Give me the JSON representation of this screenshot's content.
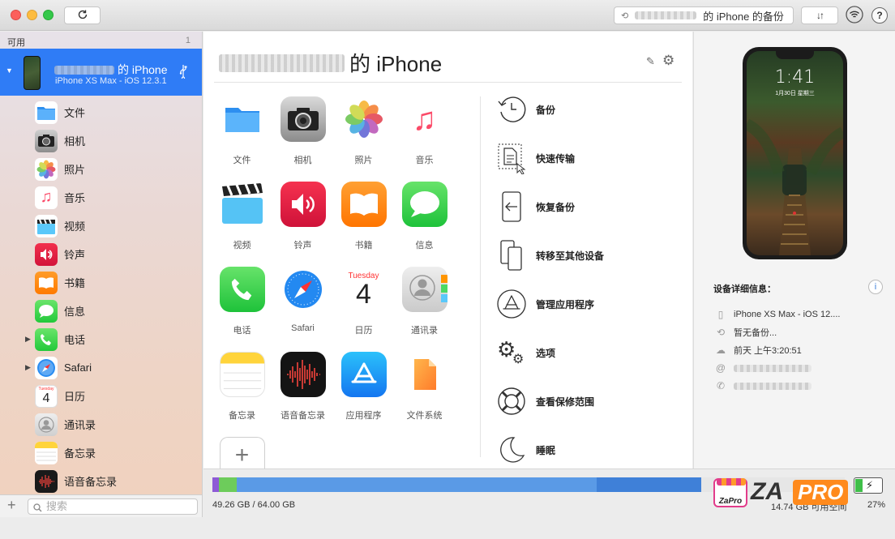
{
  "titlebar": {
    "refresh_icon": "refresh-icon",
    "backup_button_label": "的 iPhone 的备份",
    "transfer_icon": "transfer-arrows-icon",
    "wifi_icon": "wifi-icon",
    "help_label": "?"
  },
  "sidebar": {
    "section_label": "可用",
    "section_count": "1",
    "device": {
      "name": "的 iPhone",
      "subtitle": "iPhone XS Max - iOS 12.3.1",
      "usb_icon": "usb-icon"
    },
    "items": [
      {
        "label": "文件",
        "icon": "files-icon"
      },
      {
        "label": "相机",
        "icon": "camera-icon"
      },
      {
        "label": "照片",
        "icon": "photos-icon"
      },
      {
        "label": "音乐",
        "icon": "music-icon"
      },
      {
        "label": "视频",
        "icon": "video-icon"
      },
      {
        "label": "铃声",
        "icon": "ringtone-icon"
      },
      {
        "label": "书籍",
        "icon": "books-icon"
      },
      {
        "label": "信息",
        "icon": "messages-icon"
      },
      {
        "label": "电话",
        "icon": "phone-icon"
      },
      {
        "label": "Safari",
        "icon": "safari-icon"
      },
      {
        "label": "日历",
        "icon": "calendar-icon",
        "day": "4",
        "weekday": "Tuesday"
      },
      {
        "label": "通讯录",
        "icon": "contacts-icon"
      },
      {
        "label": "备忘录",
        "icon": "notes-icon"
      },
      {
        "label": "语音备忘录",
        "icon": "voice-memos-icon"
      }
    ],
    "add_label": "+",
    "search_placeholder": "搜索"
  },
  "main": {
    "title": "的 iPhone",
    "apps": [
      {
        "label": "文件"
      },
      {
        "label": "相机"
      },
      {
        "label": "照片"
      },
      {
        "label": "音乐"
      },
      {
        "label": "视频"
      },
      {
        "label": "铃声"
      },
      {
        "label": "书籍"
      },
      {
        "label": "信息"
      },
      {
        "label": "电话"
      },
      {
        "label": "Safari"
      },
      {
        "label": "日历"
      },
      {
        "label": "通讯录"
      },
      {
        "label": "备忘录"
      },
      {
        "label": "语音备忘录"
      },
      {
        "label": "应用程序"
      },
      {
        "label": "文件系统"
      }
    ],
    "calendar_weekday": "Tuesday",
    "calendar_day": "4",
    "add_app_label": "+",
    "actions": [
      {
        "label": "备份",
        "icon": "backup-clock-icon"
      },
      {
        "label": "快速传输",
        "icon": "quick-transfer-icon"
      },
      {
        "label": "恢复备份",
        "icon": "restore-backup-icon"
      },
      {
        "label": "转移至其他设备",
        "icon": "transfer-device-icon"
      },
      {
        "label": "管理应用程序",
        "icon": "app-store-icon"
      },
      {
        "label": "选项",
        "icon": "gears-icon"
      },
      {
        "label": "查看保修范围",
        "icon": "lifebuoy-icon"
      },
      {
        "label": "睡眠",
        "icon": "moon-icon"
      }
    ]
  },
  "details": {
    "lock_time": "1:41",
    "lock_date": "1月30日 星期三",
    "title": "设备详细信息：",
    "info_label": "i",
    "rows": [
      {
        "icon": "iphone-icon",
        "text": "iPhone XS Max - iOS 12...."
      },
      {
        "icon": "history-icon",
        "text": "暂无备份..."
      },
      {
        "icon": "cloud-icon",
        "text": "前天 上午3:20:51"
      },
      {
        "icon": "at-icon",
        "text": ""
      },
      {
        "icon": "phone-icon",
        "text": ""
      }
    ]
  },
  "storage": {
    "used": "49.26 GB / 64.00 GB",
    "free": "14.74 GB 可用空间",
    "battery_percent": "27%",
    "battery_level": 0.27,
    "segments": [
      {
        "name": "apps",
        "fraction": 0.01,
        "color": "#8e5bd6"
      },
      {
        "name": "photos",
        "fraction": 0.028,
        "color": "#6dcc5b"
      },
      {
        "name": "media",
        "fraction": 0.57,
        "color": "#5a9ae6"
      },
      {
        "name": "other",
        "fraction": 0.165,
        "color": "#3f80d8"
      }
    ]
  },
  "watermark": {
    "small": "ZaPro",
    "big_a": "ZA",
    "big_b": "PRO"
  }
}
